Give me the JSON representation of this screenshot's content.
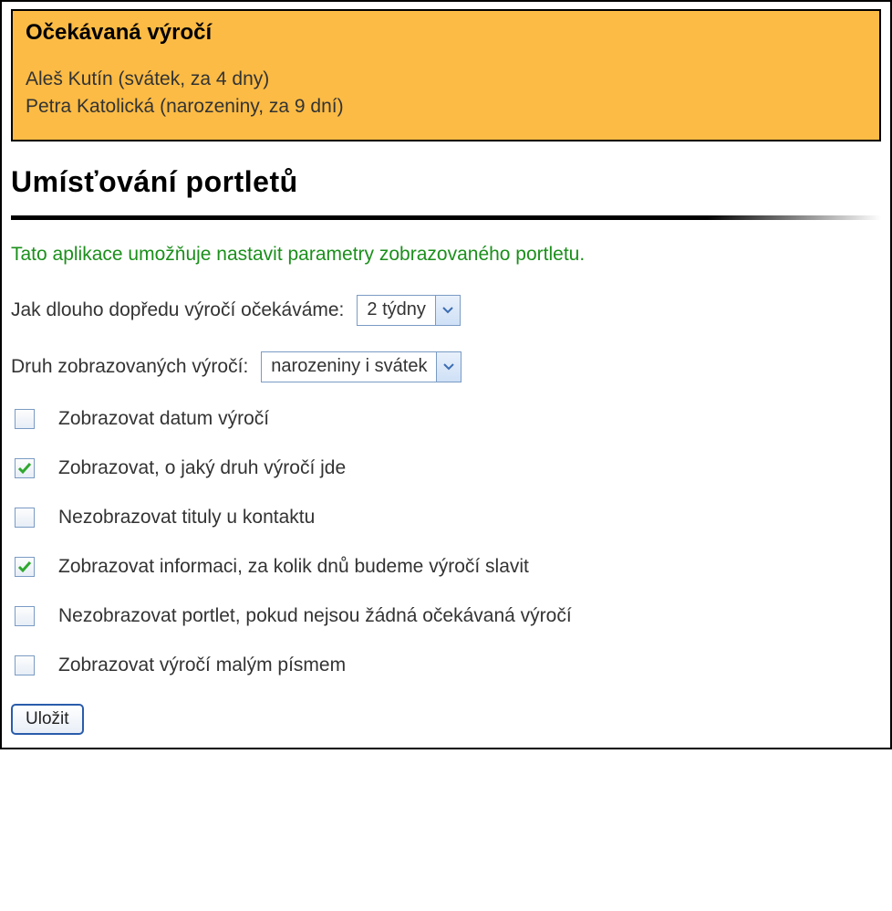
{
  "anniversaries": {
    "title": "Očekávaná výročí",
    "items": [
      "Aleš Kutín (svátek, za 4 dny)",
      "Petra Katolická (narozeniny, za 9 dní)"
    ]
  },
  "heading": "Umísťování portletů",
  "intro": "Tato aplikace umožňuje nastavit parametry zobrazovaného portletu.",
  "form": {
    "lookahead_label": "Jak dlouho dopředu výročí očekáváme:",
    "lookahead_value": "2 týdny",
    "type_label": "Druh zobrazovaných výročí:",
    "type_value": "narozeniny i svátek"
  },
  "options": [
    {
      "label": "Zobrazovat datum výročí",
      "checked": false
    },
    {
      "label": "Zobrazovat, o jaký druh výročí jde",
      "checked": true
    },
    {
      "label": "Nezobrazovat tituly u kontaktu",
      "checked": false
    },
    {
      "label": "Zobrazovat informaci, za kolik dnů budeme výročí slavit",
      "checked": true
    },
    {
      "label": "Nezobrazovat portlet, pokud nejsou žádná očekávaná výročí",
      "checked": false
    },
    {
      "label": "Zobrazovat výročí malým písmem",
      "checked": false
    }
  ],
  "save_label": "Uložit"
}
